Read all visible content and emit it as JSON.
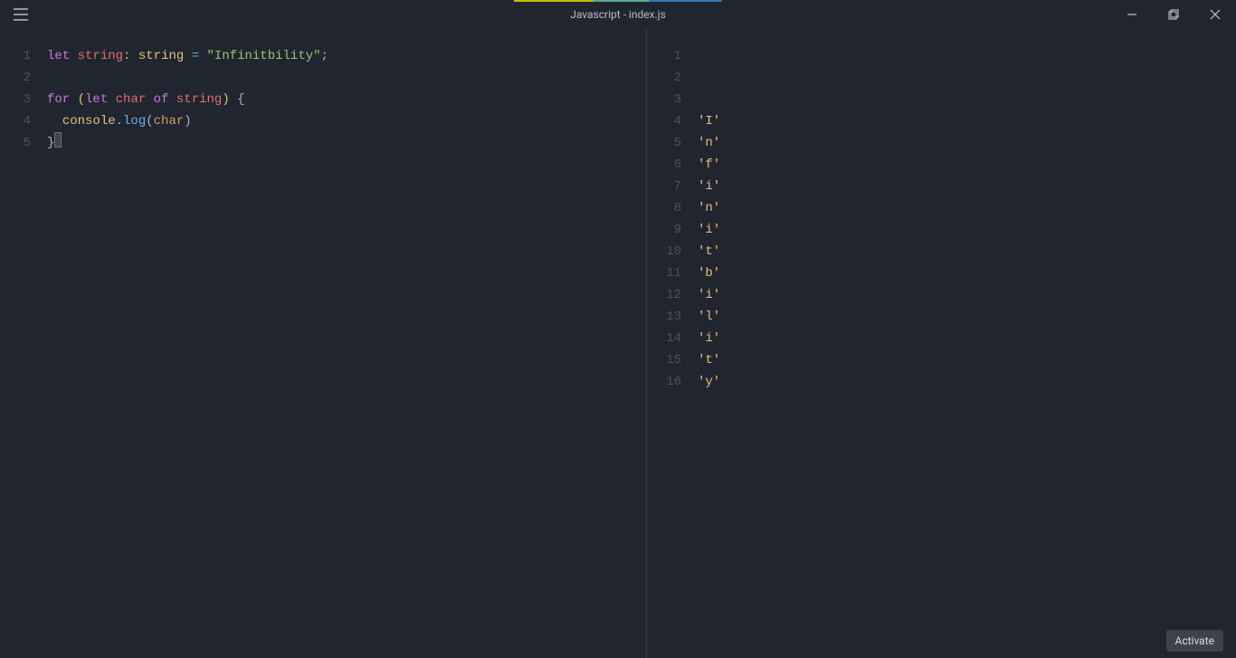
{
  "window": {
    "title": "Javascript - index.js",
    "activate_label": "Activate"
  },
  "editor": {
    "lines": [
      {
        "n": 1,
        "tokens": [
          {
            "cls": "tok-kw",
            "t": "let"
          },
          {
            "cls": "",
            "t": " "
          },
          {
            "cls": "tok-var",
            "t": "string"
          },
          {
            "cls": "tok-colon",
            "t": ":"
          },
          {
            "cls": "",
            "t": " "
          },
          {
            "cls": "tok-type",
            "t": "string"
          },
          {
            "cls": "",
            "t": " "
          },
          {
            "cls": "tok-op",
            "t": "="
          },
          {
            "cls": "",
            "t": " "
          },
          {
            "cls": "tok-str",
            "t": "\"Infinitbility\""
          },
          {
            "cls": "tok-semi",
            "t": ";"
          }
        ]
      },
      {
        "n": 2,
        "tokens": []
      },
      {
        "n": 3,
        "tokens": [
          {
            "cls": "tok-kw",
            "t": "for"
          },
          {
            "cls": "",
            "t": " "
          },
          {
            "cls": "tok-paren",
            "t": "("
          },
          {
            "cls": "tok-kw",
            "t": "let"
          },
          {
            "cls": "",
            "t": " "
          },
          {
            "cls": "tok-var",
            "t": "char"
          },
          {
            "cls": "",
            "t": " "
          },
          {
            "cls": "tok-kw",
            "t": "of"
          },
          {
            "cls": "",
            "t": " "
          },
          {
            "cls": "tok-var",
            "t": "string"
          },
          {
            "cls": "tok-paren",
            "t": ")"
          },
          {
            "cls": "",
            "t": " "
          },
          {
            "cls": "tok-brace",
            "t": "{"
          }
        ]
      },
      {
        "n": 4,
        "tokens": [
          {
            "cls": "",
            "t": "  "
          },
          {
            "cls": "tok-obj",
            "t": "console"
          },
          {
            "cls": "tok-dot",
            "t": "."
          },
          {
            "cls": "tok-fn",
            "t": "log"
          },
          {
            "cls": "tok-callp",
            "t": "("
          },
          {
            "cls": "tok-arg",
            "t": "char"
          },
          {
            "cls": "tok-callp",
            "t": ")"
          }
        ]
      },
      {
        "n": 5,
        "tokens": [
          {
            "cls": "tok-brace",
            "t": "}"
          }
        ],
        "cursor_after": true
      }
    ]
  },
  "output": {
    "lines": [
      {
        "n": 1,
        "t": ""
      },
      {
        "n": 2,
        "t": ""
      },
      {
        "n": 3,
        "t": ""
      },
      {
        "n": 4,
        "t": "'I'"
      },
      {
        "n": 5,
        "t": "'n'"
      },
      {
        "n": 6,
        "t": "'f'"
      },
      {
        "n": 7,
        "t": "'i'"
      },
      {
        "n": 8,
        "t": "'n'"
      },
      {
        "n": 9,
        "t": "'i'"
      },
      {
        "n": 10,
        "t": "'t'"
      },
      {
        "n": 11,
        "t": "'b'"
      },
      {
        "n": 12,
        "t": "'i'"
      },
      {
        "n": 13,
        "t": "'l'"
      },
      {
        "n": 14,
        "t": "'i'"
      },
      {
        "n": 15,
        "t": "'t'"
      },
      {
        "n": 16,
        "t": "'y'"
      }
    ]
  }
}
